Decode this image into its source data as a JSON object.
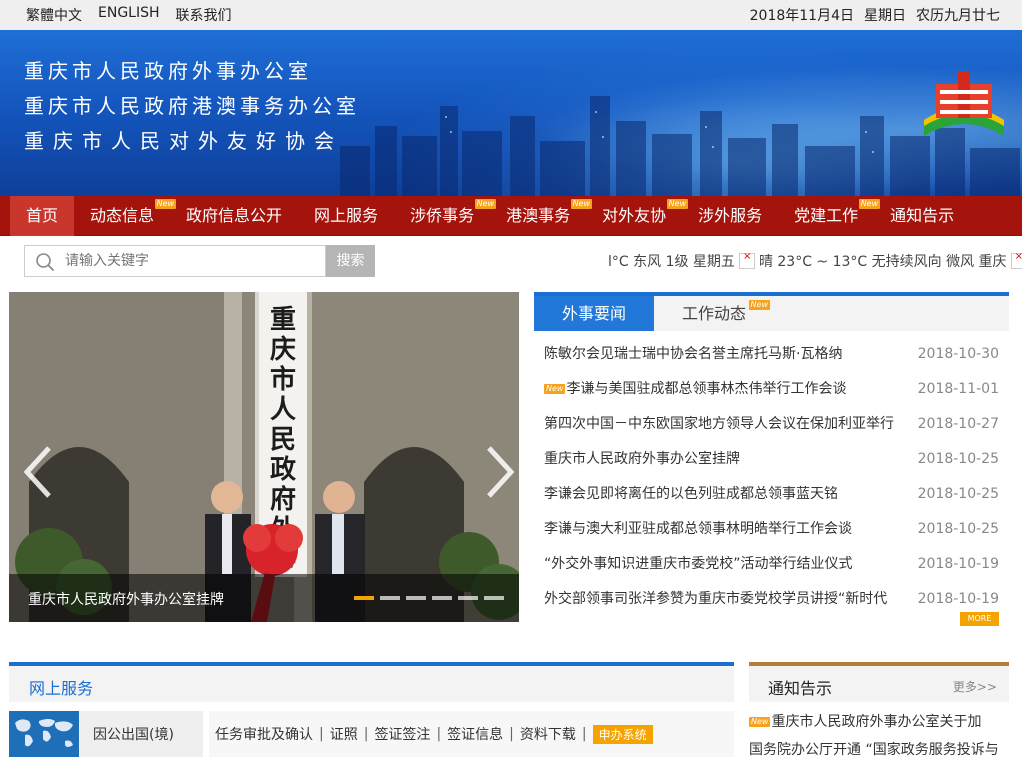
{
  "topbar": {
    "links": [
      "繁體中文",
      "ENGLISH",
      "联系我们"
    ],
    "date": "2018年11月4日",
    "weekday": "星期日",
    "lunar": "农历九月廿七"
  },
  "banner": {
    "titles": [
      "重庆市人民政府外事办公室",
      "重庆市人民政府港澳事务办公室",
      "重庆市人民对外友好协会"
    ],
    "colors": {
      "sky": "#1457bf",
      "nav": "#a4140c",
      "accent": "#1b6ed1",
      "badge": "#f7a21b"
    }
  },
  "nav": {
    "items": [
      {
        "label": "首页",
        "active": true,
        "new": false
      },
      {
        "label": "动态信息",
        "active": false,
        "new": true
      },
      {
        "label": "政府信息公开",
        "active": false,
        "new": false
      },
      {
        "label": "网上服务",
        "active": false,
        "new": false
      },
      {
        "label": "涉侨事务",
        "active": false,
        "new": true
      },
      {
        "label": "港澳事务",
        "active": false,
        "new": true
      },
      {
        "label": "对外友协",
        "active": false,
        "new": true
      },
      {
        "label": "涉外服务",
        "active": false,
        "new": false
      },
      {
        "label": "党建工作",
        "active": false,
        "new": true
      },
      {
        "label": "通知告示",
        "active": false,
        "new": false
      }
    ],
    "new_badge": "New"
  },
  "search": {
    "placeholder": "请输入关键字",
    "button": "搜索"
  },
  "weather": {
    "part1": "l°C 东风 1级 星期五",
    "part2": "晴 23°C ~ 13°C 无持续风向 微风 重庆"
  },
  "slideshow": {
    "caption": "重庆市人民政府外事办公室挂牌",
    "sign_text": "重庆市人民政府外事办公",
    "slide_count": 6,
    "active_index": 0
  },
  "news": {
    "tabs": [
      {
        "label": "外事要闻",
        "active": true,
        "new": false
      },
      {
        "label": "工作动态",
        "active": false,
        "new": true
      }
    ],
    "items": [
      {
        "title": "陈敏尔会见瑞士瑞中协会名誉主席托马斯·瓦格纳",
        "date": "2018-10-30",
        "new": false
      },
      {
        "title": "李谦与美国驻成都总领事林杰伟举行工作会谈",
        "date": "2018-11-01",
        "new": true
      },
      {
        "title": "第四次中国－中东欧国家地方领导人会议在保加利亚举行",
        "date": "2018-10-27",
        "new": false
      },
      {
        "title": "重庆市人民政府外事办公室挂牌",
        "date": "2018-10-25",
        "new": false
      },
      {
        "title": "李谦会见即将离任的以色列驻成都总领事蓝天铭",
        "date": "2018-10-25",
        "new": false
      },
      {
        "title": "李谦与澳大利亚驻成都总领事林明皓举行工作会谈",
        "date": "2018-10-25",
        "new": false
      },
      {
        "title": "“外交外事知识进重庆市委党校”活动举行结业仪式",
        "date": "2018-10-19",
        "new": false
      },
      {
        "title": "外交部领事司张洋参赞为重庆市委党校学员讲授“新时代",
        "date": "2018-10-19",
        "new": false
      }
    ],
    "more": "MORE"
  },
  "services": {
    "title": "网上服务",
    "tile_label": "因公出国(境)",
    "links": [
      "任务审批及确认",
      "证照",
      "签证签注",
      "签证信息",
      "资料下载"
    ],
    "system_button": "申办系统"
  },
  "notices": {
    "title": "通知告示",
    "more": "更多>>",
    "items": [
      {
        "title": "重庆市人民政府外事办公室关于加",
        "new": true
      },
      {
        "title": "国务院办公厅开通 “国家政务服务投诉与",
        "new": false
      }
    ]
  }
}
